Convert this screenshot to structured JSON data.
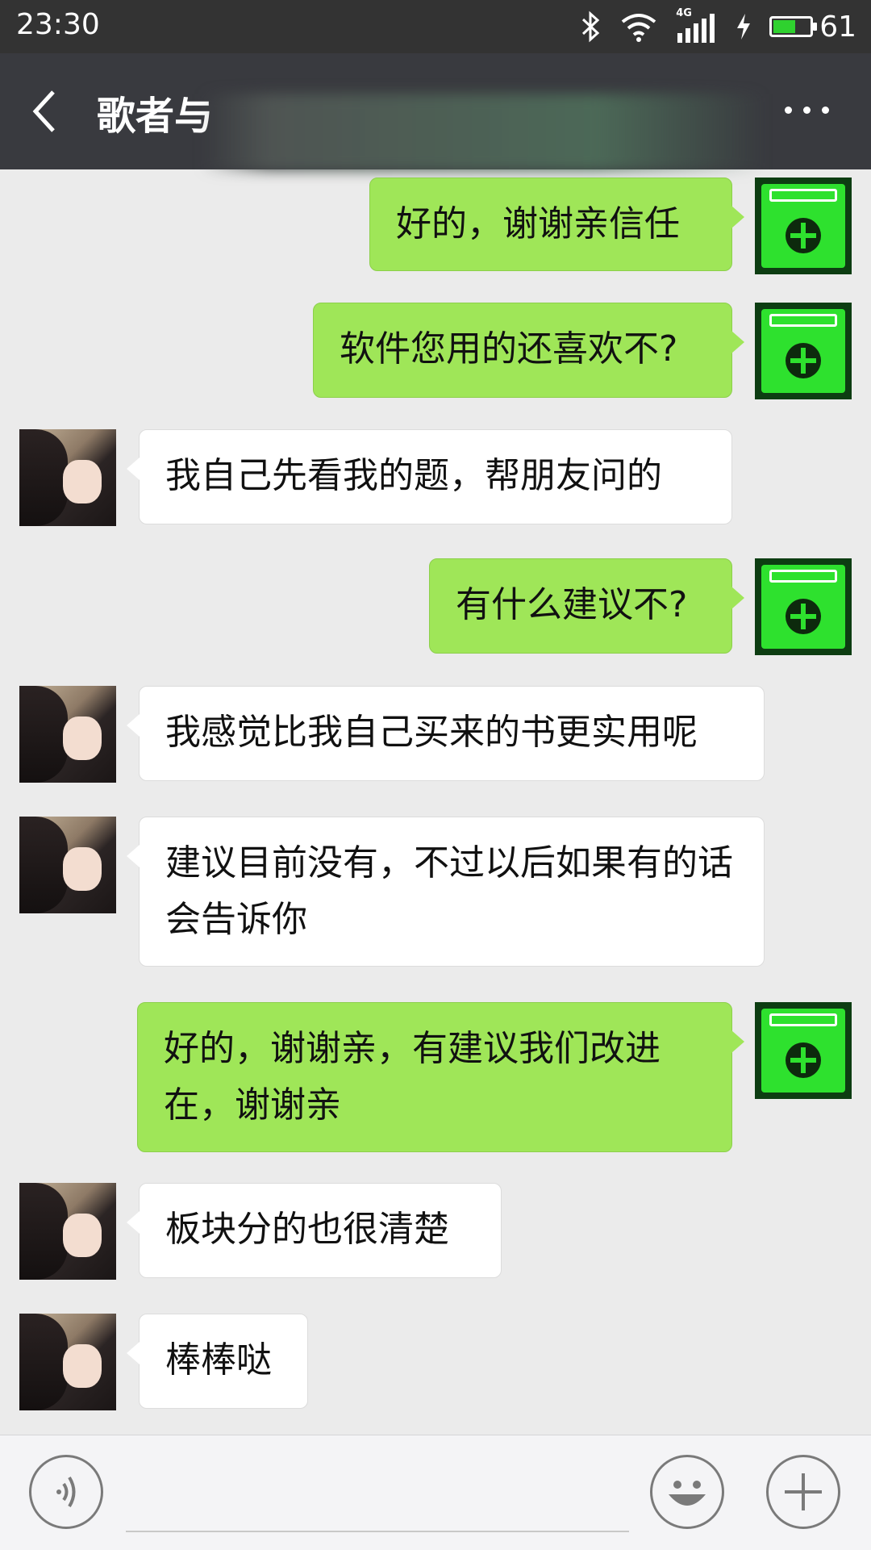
{
  "status_bar": {
    "time": "23:30",
    "network": "4G",
    "battery": "61",
    "battery_level": 0.61,
    "icons": [
      "bluetooth-icon",
      "wifi-icon",
      "signal-icon",
      "charging-icon",
      "battery-icon"
    ]
  },
  "header": {
    "title": "歌者与",
    "back_icon": "chevron-left-icon",
    "more_icon": "more-horizontal-icon"
  },
  "messages": [
    {
      "sender": "self",
      "text": "好的，谢谢亲信任"
    },
    {
      "sender": "self",
      "text": "软件您用的还喜欢不?"
    },
    {
      "sender": "other",
      "text": "我自己先看我的题，帮朋友问的"
    },
    {
      "sender": "self",
      "text": "有什么建议不?"
    },
    {
      "sender": "other",
      "text": "我感觉比我自己买来的书更实用呢"
    },
    {
      "sender": "other",
      "text": "建议目前没有，不过以后如果有的话会告诉你"
    },
    {
      "sender": "self",
      "text": "好的，谢谢亲，有建议我们改进在，谢谢亲"
    },
    {
      "sender": "other",
      "text": "板块分的也很清楚"
    },
    {
      "sender": "other",
      "text": "棒棒哒"
    }
  ],
  "input_bar": {
    "voice_icon": "voice-icon",
    "emoji_icon": "emoji-icon",
    "add_icon": "plus-icon"
  },
  "colors": {
    "self_bubble": "#9fe658",
    "other_bubble": "#ffffff",
    "header_bg": "#393a3f",
    "chat_bg": "#ebebeb"
  }
}
